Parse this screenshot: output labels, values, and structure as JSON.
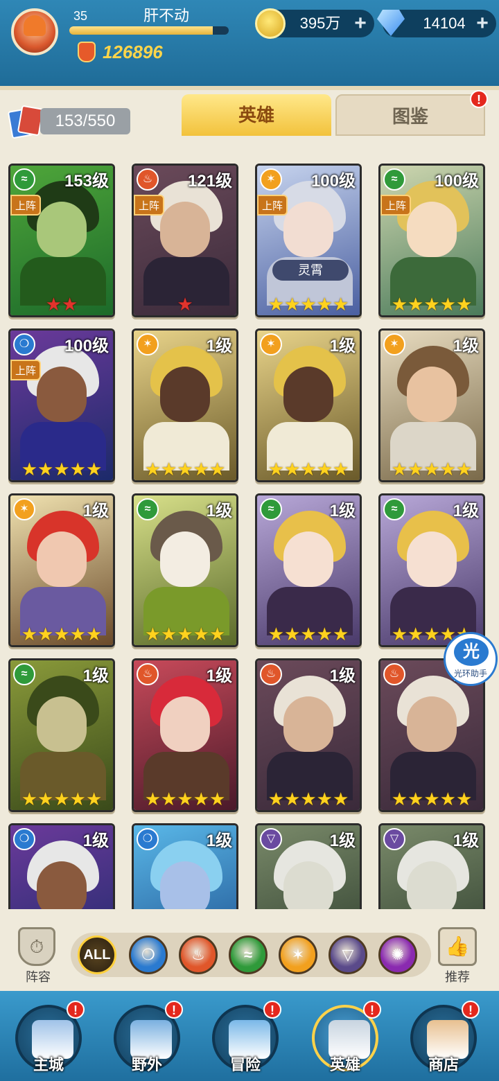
{
  "player": {
    "level": "35",
    "name": "肝不动",
    "xp_fraction": 0.9,
    "power": "126896"
  },
  "currency": {
    "coins": "395万",
    "gems": "14104",
    "plus": "+"
  },
  "heroes_tab": {
    "count": "153/550",
    "tabs": [
      {
        "label": "英雄"
      },
      {
        "label": "图鉴"
      }
    ],
    "alert": "!"
  },
  "hero_cards": [
    {
      "level": "153级",
      "deployed": "上阵",
      "element": "wind",
      "stars": "★★",
      "star_color": "red",
      "bg": [
        "#1c6a2a",
        "#4fa63a"
      ],
      "hair": "#1f3b16",
      "skin": "#a9c77a",
      "body": "#235b1c"
    },
    {
      "level": "121级",
      "deployed": "上阵",
      "element": "fire",
      "stars": "★",
      "star_color": "red",
      "bg": [
        "#3a2a3a",
        "#6b4a5a"
      ],
      "hair": "#e9e2d6",
      "skin": "#d8b497",
      "body": "#2b2436"
    },
    {
      "level": "100级",
      "deployed": "上阵",
      "element": "light",
      "stars": "★★★★★",
      "star_color": "gold",
      "skin_name": "灵霄",
      "bg": [
        "#4a5fa0",
        "#c7d4ee"
      ],
      "hair": "#d7dbe6",
      "skin": "#f2ddd2",
      "body": "#c0c6d8"
    },
    {
      "level": "100级",
      "deployed": "上阵",
      "element": "wind",
      "stars": "★★★★★",
      "star_color": "gold",
      "bg": [
        "#4a7a5a",
        "#cfd7b0"
      ],
      "hair": "#e2c25a",
      "skin": "#f5dcc0",
      "body": "#3c6a3a"
    },
    {
      "level": "100级",
      "deployed": "上阵",
      "element": "water",
      "stars": "★★★★★",
      "star_color": "gold",
      "bg": [
        "#1c2a6a",
        "#6b3a9a"
      ],
      "hair": "#e7e7e7",
      "skin": "#8a5a3e",
      "body": "#2a2a8a"
    },
    {
      "level": "1级",
      "element": "light",
      "stars": "★★★★★",
      "star_color": "gold",
      "bg": [
        "#6a5a2a",
        "#e9d48a"
      ],
      "hair": "#e4c24a",
      "skin": "#5a3a2a",
      "body": "#f0ead6"
    },
    {
      "level": "1级",
      "element": "light",
      "stars": "★★★★★",
      "star_color": "gold",
      "bg": [
        "#6a5a2a",
        "#e9d48a"
      ],
      "hair": "#e4c24a",
      "skin": "#5a3a2a",
      "body": "#f0ead6"
    },
    {
      "level": "1级",
      "element": "light",
      "stars": "★★★★★",
      "star_color": "gold",
      "bg": [
        "#7a6a4a",
        "#e8dcc0"
      ],
      "hair": "#7a5a3a",
      "skin": "#e8c2a0",
      "body": "#dcd6c8"
    },
    {
      "level": "1级",
      "element": "light",
      "stars": "★★★★★",
      "star_color": "gold",
      "bg": [
        "#6a4a2a",
        "#f0e2b0"
      ],
      "hair": "#d8342a",
      "skin": "#f0c8b0",
      "body": "#6a5aa0"
    },
    {
      "level": "1级",
      "element": "wind",
      "stars": "★★★★★",
      "star_color": "gold",
      "bg": [
        "#5a6a2a",
        "#d8e08a"
      ],
      "hair": "#6a5a4a",
      "skin": "#f3ede2",
      "body": "#7a9a2a"
    },
    {
      "level": "1级",
      "element": "wind",
      "stars": "★★★★★",
      "star_color": "gold",
      "bg": [
        "#4a3a6a",
        "#b8a8d8"
      ],
      "hair": "#e8c04a",
      "skin": "#f6e0d2",
      "body": "#3a2a4a"
    },
    {
      "level": "1级",
      "element": "wind",
      "stars": "★★★★★",
      "star_color": "gold",
      "bg": [
        "#4a3a6a",
        "#b8a8d8"
      ],
      "hair": "#e8c04a",
      "skin": "#f6e0d2",
      "body": "#3a2a4a"
    },
    {
      "level": "1级",
      "element": "wind",
      "stars": "★★★★★",
      "star_color": "gold",
      "bg": [
        "#3a4a1a",
        "#8a9a3a"
      ],
      "hair": "#3a4a1a",
      "skin": "#c8c090",
      "body": "#6a5a2a"
    },
    {
      "level": "1级",
      "element": "fire",
      "stars": "★★★★★",
      "star_color": "gold",
      "bg": [
        "#4a1a2a",
        "#c84a5a"
      ],
      "hair": "#d82a3a",
      "skin": "#f0d0c0",
      "body": "#5a3a2a"
    },
    {
      "level": "1级",
      "element": "fire",
      "stars": "★★★★★",
      "star_color": "gold",
      "bg": [
        "#3a2a3a",
        "#6b4a5a"
      ],
      "hair": "#e9e2d6",
      "skin": "#d8b497",
      "body": "#2b2436"
    },
    {
      "level": "1级",
      "element": "fire",
      "stars": "★★★★★",
      "star_color": "gold",
      "bg": [
        "#3a2a3a",
        "#6b4a5a"
      ],
      "hair": "#e9e2d6",
      "skin": "#d8b497",
      "body": "#2b2436"
    },
    {
      "level": "1级",
      "element": "water",
      "stars": "",
      "star_color": "gold",
      "bg": [
        "#1c2a6a",
        "#6b3a9a"
      ],
      "hair": "#e7e7e7",
      "skin": "#8a5a3e",
      "body": "#2a2a8a"
    },
    {
      "level": "1级",
      "element": "water",
      "stars": "",
      "star_color": "gold",
      "bg": [
        "#1a4a8a",
        "#5ab8e8"
      ],
      "hair": "#8ad0f0",
      "skin": "#a8c0e8",
      "body": "#3a7ac0"
    },
    {
      "level": "1级",
      "element": "dark",
      "stars": "",
      "star_color": "gold",
      "bg": [
        "#2a3a2a",
        "#7a8a6a"
      ],
      "hair": "#e6e6e0",
      "skin": "#dcdcd0",
      "body": "#6a5a3a"
    },
    {
      "level": "1级",
      "element": "dark",
      "stars": "",
      "star_color": "gold",
      "bg": [
        "#2a3a2a",
        "#7a8a6a"
      ],
      "hair": "#e6e6e0",
      "skin": "#dcdcd0",
      "body": "#6a5a3a"
    }
  ],
  "elements": {
    "wind": {
      "color": "#2f9a3a",
      "glyph": "≈"
    },
    "fire": {
      "color": "#e0562a",
      "glyph": "♨"
    },
    "light": {
      "color": "#f2a01e",
      "glyph": "✶"
    },
    "water": {
      "color": "#2a7ad0",
      "glyph": "❍"
    },
    "dark": {
      "color": "#6a4aa0",
      "glyph": "▽"
    }
  },
  "filters": {
    "lineup_label": "阵容",
    "recommend_label": "推荐",
    "all_label": "ALL",
    "buttons": [
      {
        "name": "water",
        "color": "#2a7ad0",
        "glyph": "❍"
      },
      {
        "name": "fire",
        "color": "#e0562a",
        "glyph": "♨"
      },
      {
        "name": "wind",
        "color": "#2f9a3a",
        "glyph": "≈"
      },
      {
        "name": "light",
        "color": "#f2a01e",
        "glyph": "✶"
      },
      {
        "name": "dark",
        "color": "#5a4a8a",
        "glyph": "▽"
      },
      {
        "name": "chaos",
        "color": "#8a2ab0",
        "glyph": "✺"
      }
    ]
  },
  "helper": {
    "glyph": "光",
    "label": "光环助手"
  },
  "bottom_nav": [
    {
      "label": "主城",
      "alert": "!",
      "icon": "castle-icon",
      "color": "#9fc2e8"
    },
    {
      "label": "野外",
      "alert": "!",
      "icon": "portal-icon",
      "color": "#7ab0e0"
    },
    {
      "label": "冒险",
      "alert": "!",
      "icon": "sword-icon",
      "color": "#7ab8e8"
    },
    {
      "label": "英雄",
      "alert": "!",
      "icon": "helmet-icon",
      "color": "#c7d4e0",
      "active": true
    },
    {
      "label": "商店",
      "alert": "!",
      "icon": "shop-icon",
      "color": "#e8c090"
    }
  ]
}
